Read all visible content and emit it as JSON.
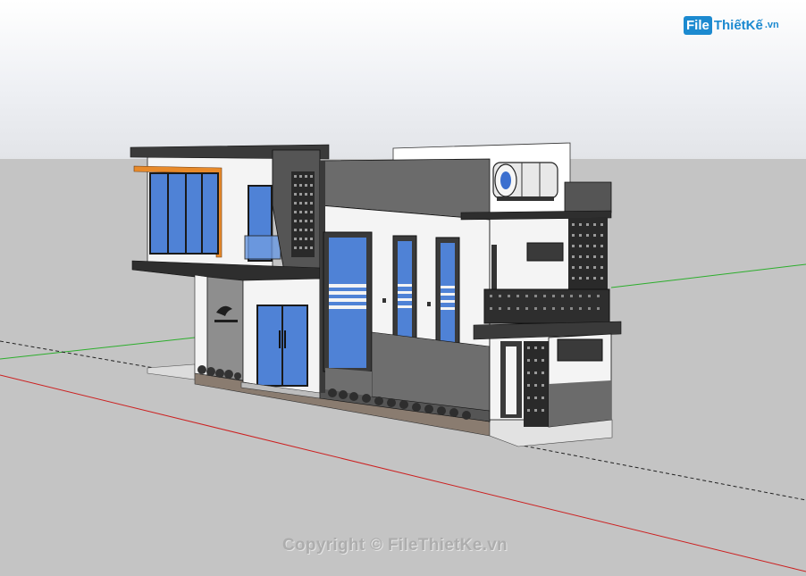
{
  "logo": {
    "file_text": "File",
    "brand_text": "ThiếtKế",
    "tld_text": ".vn"
  },
  "watermark": {
    "text": "Copyright © FileThietKe.vn"
  },
  "scene": {
    "type": "3d-model-viewport",
    "subject": "two-storey modern townhouse",
    "colors": {
      "sky": "#ffffff",
      "ground": "#c4c4c4",
      "wall_white": "#f4f4f4",
      "wall_gray": "#6b6b6b",
      "wall_dark": "#3a3a3a",
      "glass": "#4f82d6",
      "accent_orange": "#e88a2a",
      "axis_red": "#cc2020",
      "axis_green": "#2cae2c"
    },
    "icons": [
      "water-tank-icon",
      "brand-bird-logo-icon"
    ]
  }
}
